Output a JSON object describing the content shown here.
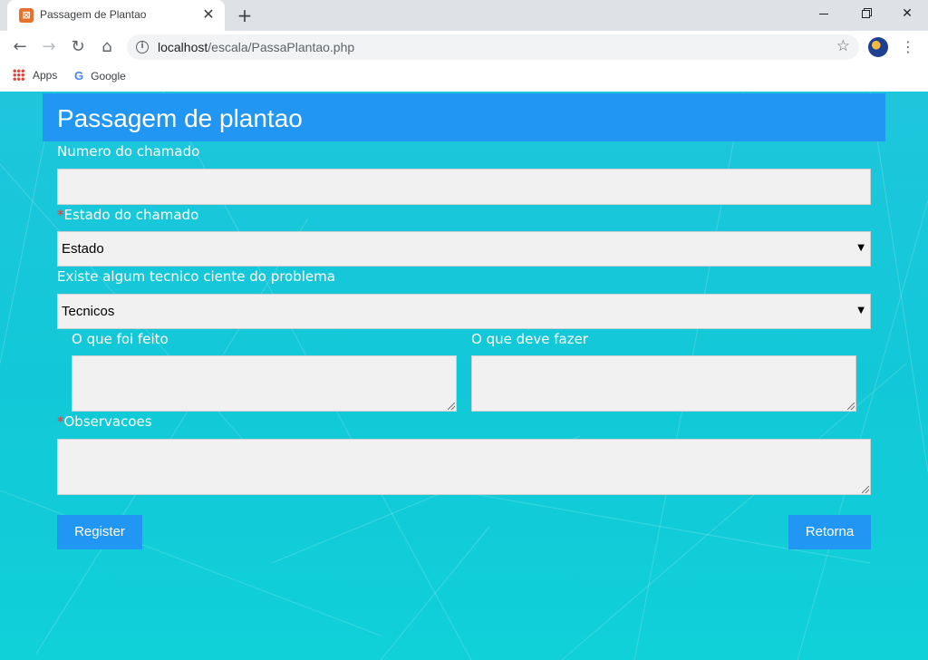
{
  "browser": {
    "tab_title": "Passagem de Plantao",
    "url_host": "localhost",
    "url_path": "/escala/PassaPlantao.php",
    "bookmarks": [
      {
        "label": "Apps",
        "icon": "apps-grid-icon"
      },
      {
        "label": "Google",
        "icon": "google-icon"
      }
    ]
  },
  "page": {
    "title": "Passagem de plantao",
    "fields": {
      "numero_label": "Numero do chamado",
      "estado_label": "Estado do chamado",
      "estado_value": "Estado",
      "tecnico_label": "Existe algum tecnico ciente do problema",
      "tecnico_value": "Tecnicos",
      "feito_label": "O que foi feito",
      "fazer_label": "O que deve fazer",
      "obs_label": "Observacoes",
      "required_mark": "*"
    },
    "buttons": {
      "register": "Register",
      "retorna": "Retorna"
    }
  },
  "colors": {
    "header": "#2196f3",
    "background": "#12c8d8",
    "required": "#e53935"
  }
}
